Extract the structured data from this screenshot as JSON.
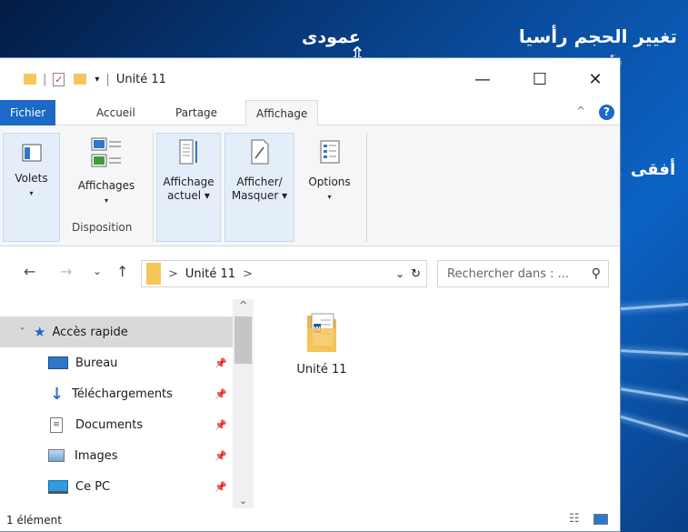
{
  "annotations": {
    "resize": "تغيير الحجم رأسيا",
    "vertical": "عمودى",
    "horizontal": "أفقى"
  },
  "window": {
    "title": "Unité 11",
    "qat_dropdown": "▾",
    "controls": {
      "minimize": "—",
      "maximize": "☐",
      "close": "✕"
    }
  },
  "ribbon_tabs": [
    "Fichier",
    "Accueil",
    "Partage",
    "Affichage"
  ],
  "active_tab": "Affichage",
  "ribbon_collapse": "^",
  "help": "?",
  "ribbon": {
    "panes": {
      "label": "Volets",
      "drop": "▾"
    },
    "layouts": {
      "label": "Affichages",
      "drop": "▾"
    },
    "disposition_label": "Disposition",
    "current_view": {
      "line1": "Affichage",
      "line2": "actuel ▾"
    },
    "show_hide": {
      "line1": "Afficher/",
      "line2": "Masquer ▾"
    },
    "options": {
      "label": "Options",
      "drop": "▾"
    }
  },
  "nav": {
    "back": "←",
    "forward": "→",
    "recent": "⌄",
    "up": "↑",
    "breadcrumb_sep": ">",
    "breadcrumb": "Unité 11",
    "breadcrumb_end": ">",
    "addr_drop": "⌄",
    "refresh": "↻",
    "search_placeholder": "Rechercher dans : ...",
    "search_icon": "⚲"
  },
  "sidebar": {
    "quick_access": "Accès rapide",
    "items": [
      "Bureau",
      "Téléchargements",
      "Documents",
      "Images",
      "Ce PC"
    ],
    "scroll_up": "^",
    "scroll_down": "⌄"
  },
  "content": {
    "file_name": "Unité 11"
  },
  "status": {
    "count": "1 élément"
  },
  "colors": {
    "accent": "#1c69c7",
    "folder": "#f6c65b",
    "ribbon_bg": "#f5f6f7",
    "highlight_group": "#e4eef9"
  }
}
